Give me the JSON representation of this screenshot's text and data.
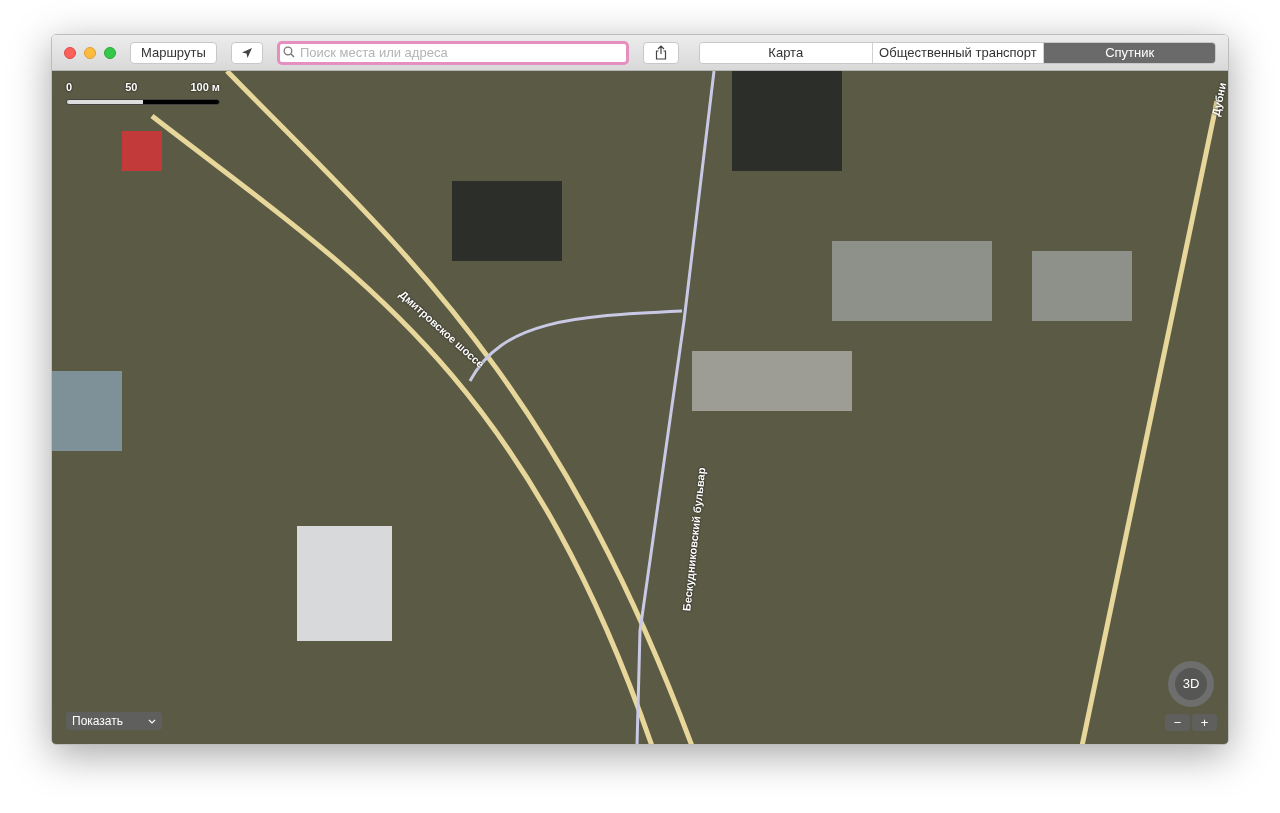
{
  "toolbar": {
    "routes_button": "Маршруты",
    "search": {
      "placeholder": "Поиск места или адреса"
    },
    "view_tabs": [
      {
        "label": "Карта",
        "selected": false
      },
      {
        "label": "Общественный транспорт",
        "selected": false
      },
      {
        "label": "Спутник",
        "selected": true
      }
    ]
  },
  "scale": {
    "ticks": [
      "0",
      "50",
      "100 м"
    ]
  },
  "road_labels": [
    {
      "text": "Дмитровское шоссе",
      "kind": "diagonal"
    },
    {
      "text": "Бескудниковский бульвар",
      "kind": "vertical"
    },
    {
      "text": "Дубни",
      "kind": "edge"
    }
  ],
  "show_menu": "Показать",
  "compass": {
    "label": "3D"
  },
  "zoom": {
    "out": "−",
    "in": "+"
  }
}
